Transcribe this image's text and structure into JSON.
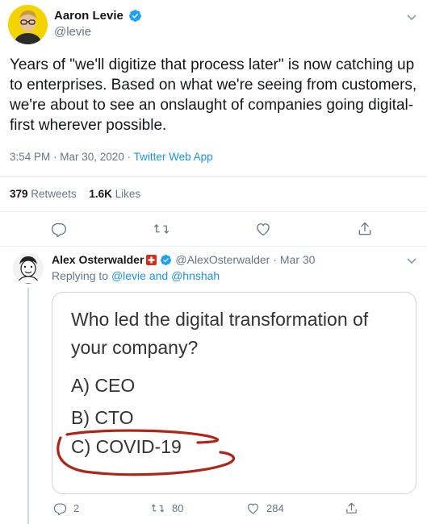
{
  "main_tweet": {
    "author_name": "Aaron Levie",
    "author_handle": "@levie",
    "text": "Years of \"we'll digitize that process later\" is now catching up to enterprises. Based on what we're seeing from customers, we're about to see an onslaught of companies going digital-first wherever possible.",
    "timestamp": "3:54 PM · Mar 30, 2020",
    "separator": " · ",
    "source": "Twitter Web App",
    "retweets_count": "379",
    "retweets_label": "Retweets",
    "likes_count": "1.6K",
    "likes_label": "Likes"
  },
  "reply_tweet": {
    "author_name": "Alex Osterwalder",
    "author_handle": "@AlexOsterwalder",
    "date": "· Mar 30",
    "replying_prefix": "Replying to",
    "replying_users": "@levie and @hnshah",
    "image_question": "Who led the digital transformation of your company?",
    "image_option_a": "A) CEO",
    "image_option_b": "B) CTO",
    "image_option_c": "C) COVID-19",
    "reply_count": "2",
    "retweet_count": "80",
    "like_count": "284"
  },
  "icons": {
    "verified": "verified-badge-icon",
    "flag": "swiss-flag-icon",
    "reply": "reply-icon",
    "retweet": "retweet-icon",
    "like": "heart-icon",
    "share": "share-icon",
    "more": "chevron-down-icon"
  },
  "colors": {
    "accent": "#1da1f2",
    "link": "#1b95e0",
    "muted": "#657786",
    "circle_marker": "#b0251a"
  }
}
